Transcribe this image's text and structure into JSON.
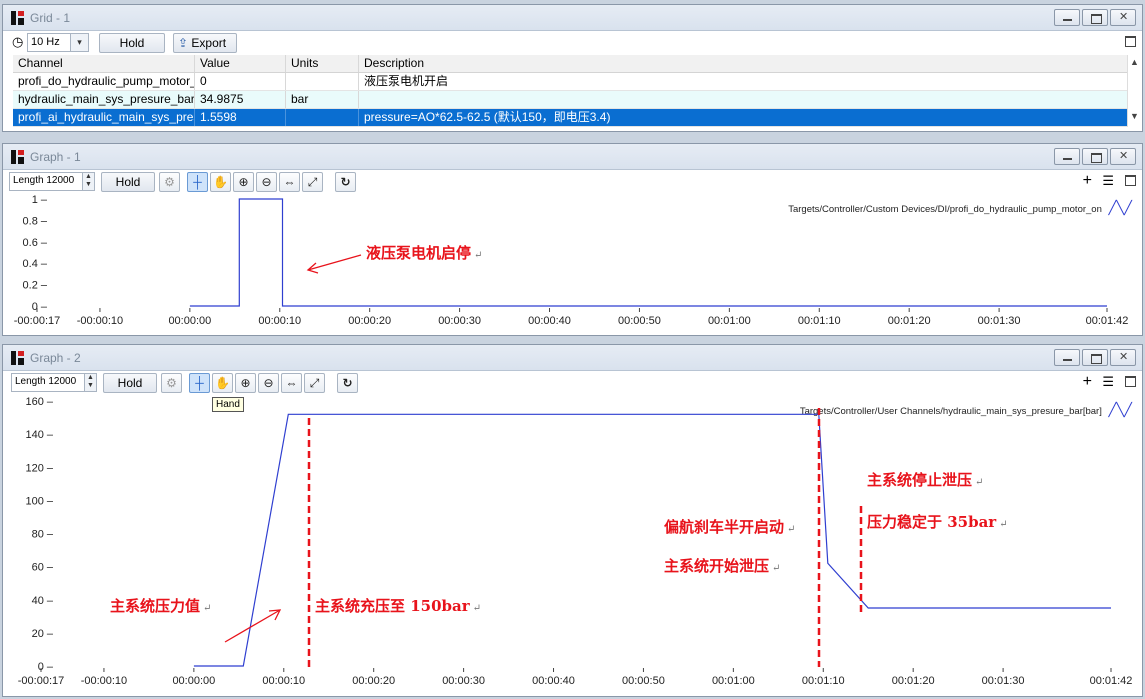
{
  "grid_panel": {
    "title": "Grid - 1",
    "rate": "10 Hz",
    "hold_label": "Hold",
    "export_label": "Export",
    "columns": [
      "Channel",
      "Value",
      "Units",
      "Description"
    ],
    "rows": [
      {
        "channel": "profi_do_hydraulic_pump_motor_c",
        "value": "0",
        "units": "",
        "description": "液压泵电机开启"
      },
      {
        "channel": "hydraulic_main_sys_presure_bar",
        "value": "34.9875",
        "units": "bar",
        "description": ""
      },
      {
        "channel": "profi_ai_hydraulic_main_sys_press",
        "value": "1.5598",
        "units": "",
        "description": "pressure=AO*62.5-62.5 (默认150，即电压3.4)"
      }
    ]
  },
  "graph1": {
    "title": "Graph - 1",
    "length_label": "Length 12000",
    "hold_label": "Hold",
    "legend": "Targets/Controller/Custom Devices/DI/profi_do_hydraulic_pump_motor_on",
    "annotation": "液压泵电机启停",
    "return_mark": "↵"
  },
  "graph2": {
    "title": "Graph - 2",
    "length_label": "Length 12000",
    "hold_label": "Hold",
    "tooltip": "Hand",
    "legend": "Targets/Controller/User Channels/hydraulic_main_sys_presure_bar[bar]",
    "annotations": {
      "pressure_value": "主系统压力值",
      "charge": "主系统充压至 150bar",
      "yaw_brake": "偏航刹车半开启动",
      "start_release": "主系统开始泄压",
      "stop_release": "主系统停止泄压",
      "stable": "压力稳定于 35bar"
    },
    "return_mark": "↵"
  },
  "colors": {
    "series": "#2f3fd0",
    "annotation": "#e8131b",
    "selection": "#0a6ed1"
  },
  "chart_data": [
    {
      "type": "line",
      "title": "",
      "x_ticks": [
        "-00:00:17",
        "-00:00:10",
        "00:00:00",
        "00:00:10",
        "00:00:20",
        "00:00:30",
        "00:00:40",
        "00:00:50",
        "00:01:00",
        "00:01:10",
        "00:01:20",
        "00:01:30",
        "00:01:42"
      ],
      "y_ticks": [
        "0",
        "0.2",
        "0.4",
        "0.6",
        "0.8",
        "1"
      ],
      "xlim": [
        -17,
        102
      ],
      "ylim": [
        0,
        1
      ],
      "series": [
        {
          "name": "Targets/Controller/Custom Devices/DI/profi_do_hydraulic_pump_motor_on",
          "x": [
            0,
            5.5,
            5.5,
            10.3,
            10.3,
            102
          ],
          "y": [
            0,
            0,
            1,
            1,
            0,
            0
          ]
        }
      ]
    },
    {
      "type": "line",
      "title": "",
      "x_ticks": [
        "-00:00:17",
        "-00:00:10",
        "00:00:00",
        "00:00:10",
        "00:00:20",
        "00:00:30",
        "00:00:40",
        "00:00:50",
        "00:01:00",
        "00:01:10",
        "00:01:20",
        "00:01:30",
        "00:01:42"
      ],
      "y_ticks": [
        "0",
        "20",
        "40",
        "60",
        "80",
        "100",
        "120",
        "140",
        "160"
      ],
      "xlim": [
        -17,
        102
      ],
      "ylim": [
        0,
        160
      ],
      "series": [
        {
          "name": "Targets/Controller/User Channels/hydraulic_main_sys_presure_bar[bar]",
          "x": [
            0,
            5.5,
            10.5,
            69.5,
            70.5,
            75,
            102
          ],
          "y": [
            0,
            0,
            152,
            152,
            62,
            35,
            35
          ]
        }
      ]
    }
  ]
}
